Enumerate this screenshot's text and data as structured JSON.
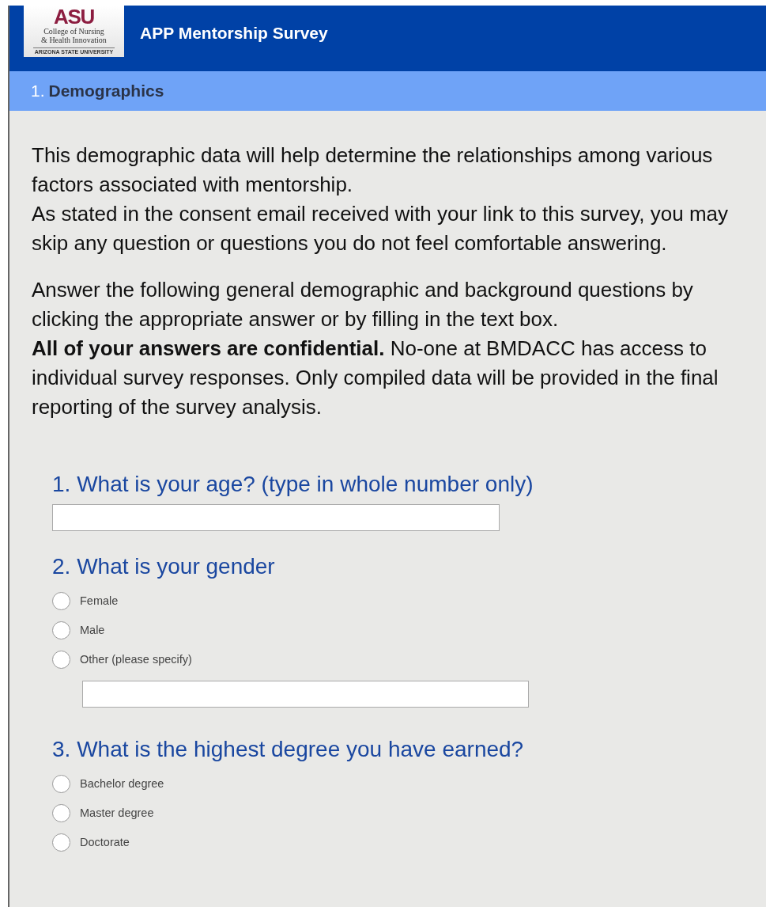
{
  "header": {
    "logo": {
      "mark": "ASU",
      "line1": "College of Nursing",
      "line2": "& Health Innovation",
      "university": "ARIZONA STATE UNIVERSITY"
    },
    "title": "APP Mentorship Survey"
  },
  "section": {
    "number": "1.",
    "title": "Demographics"
  },
  "intro": [
    [
      "This demographic data will help determine the relationships among various factors associated with mentorship.",
      "As stated in the consent email received with your link to this survey, you may skip any question or questions you do not feel comfortable answering."
    ],
    [
      "Answer the following general demographic and background questions by clicking the appropriate answer or by filling in the text box.",
      "**All of your answers are confidential.** No-one at BMDACC has access to individual survey responses. Only compiled data will be provided in the final reporting of the survey analysis."
    ]
  ],
  "questions": [
    {
      "kind": "text",
      "title": "1. What is your age? (type in whole number only)"
    },
    {
      "kind": "choice",
      "title": "2. What is your gender",
      "options": [
        {
          "label": "Female",
          "selected": false,
          "has_field": false
        },
        {
          "label": "Male",
          "selected": false,
          "has_field": false
        },
        {
          "label": "Other (please specify)",
          "selected": false,
          "has_field": true
        }
      ]
    },
    {
      "kind": "choice",
      "title": "3. What is the highest degree you have earned?",
      "options": [
        {
          "label": "Bachelor degree",
          "selected": false,
          "has_field": false
        },
        {
          "label": "Master degree",
          "selected": false,
          "has_field": false
        },
        {
          "label": "Doctorate",
          "selected": false,
          "has_field": false
        }
      ]
    }
  ]
}
